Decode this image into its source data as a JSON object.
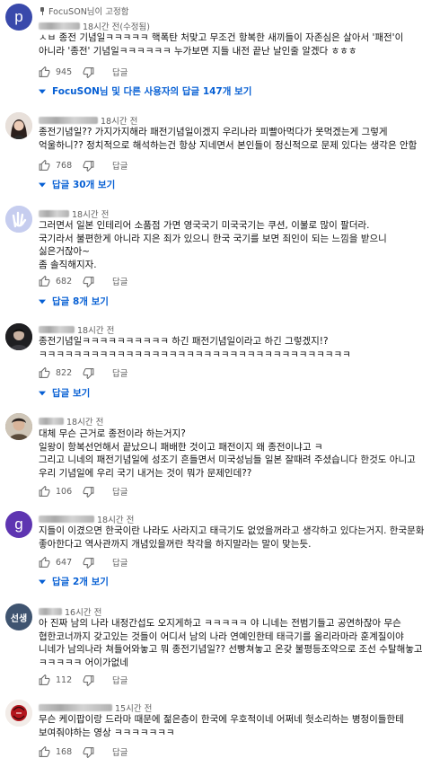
{
  "comments": [
    {
      "avatar": {
        "kind": "letter",
        "text": "p",
        "color": "#3949ab"
      },
      "pinned_text": "FocuSON님이 고정함",
      "time": "18시간 전(수정됨)",
      "text": "ㅅㅂ 종전 기념일ㅋㅋㅋㅋㅋ 핵폭탄 처맞고 무조건 항복한 새끼들이 자존심은 살아서 '패전'이 아니라 '종전' 기념일ㅋㅋㅋㅋㅋㅋ 누가보면 지들 내전 끝난 날인줄 알겠다 ㅎㅎㅎ",
      "likes": "945",
      "reply_label": "답글",
      "more_replies": "FocuSON님 및 다른 사용자의 답글 147개 보기"
    },
    {
      "avatar": {
        "kind": "photo",
        "color": "#7a6d68"
      },
      "time": "18시간 전",
      "text": "종전기념일?? 가지가지해라 패전기념일이겠지 우리나라 피빨아먹다가 못먹겠는게 그렇게 억울하니?? 정치적으로 해석하는건 항상 지네면서 본인들이 정신적으로 문제 있다는 생각은 안함",
      "likes": "768",
      "reply_label": "답글",
      "more_replies": "답글 30개 보기"
    },
    {
      "avatar": {
        "kind": "photo",
        "color": "#b8c3e6"
      },
      "time": "18시간 전",
      "text": "그러면서 일본 인테리어 소품점 가면 영국국기 미국국기는 쿠션, 이불로 많이 팔더라.\n국기라서 불편한게 아니라 지은 죄가 있으니 한국 국기를 보면 죄인이 되는 느낌을 받으니 싫은거잖아~\n좀 솔직해지자.",
      "likes": "682",
      "reply_label": "답글",
      "more_replies": "답글 8개 보기"
    },
    {
      "avatar": {
        "kind": "photo",
        "color": "#2a2a2a"
      },
      "time": "18시간 전",
      "text": "종전기념일ㅋㅋㅋㅋㅋㅋㅋㅋㅋㅋ 하긴 패전기념일이라고 하긴 그렇겠지!? ㅋㅋㅋㅋㅋㅋㅋㅋㅋㅋㅋㅋㅋㅋㅋㅋㅋㅋㅋㅋㅋㅋㅋㅋㅋㅋㅋㅋㅋㅋㅋㅋㅋㅋㅋㅋ",
      "likes": "822",
      "reply_label": "답글",
      "more_replies": "답글 보기"
    },
    {
      "avatar": {
        "kind": "photo",
        "color": "#8a7a66"
      },
      "time": "18시간 전",
      "text": "대체 무슨 근거로 종전이라 하는거지?\n일왕이 항복선언해서 끝났으니 패배한 것이고 패전이지 왜 종전이냐고 ㅋ\n그리고 니네의 패전기념일에 성조기 흔들면서 미국성님들 일본 잘때려 주셨습니다 한것도 아니고 우리 기념일에 우리 국기 내거는 것이 뭐가 문제인데??",
      "likes": "106",
      "reply_label": "답글"
    },
    {
      "avatar": {
        "kind": "letter",
        "text": "g",
        "color": "#5e35b1"
      },
      "time": "18시간 전",
      "text": "지들이 이겼으면 한국이란 나라도 사라지고 태극기도 없었을꺼라고 생각하고 있다는거지. 한국문화 좋아한다고 역사관까지 개념있을꺼란 착각을 하지말라는 말이 맞는듯.",
      "likes": "647",
      "reply_label": "답글",
      "more_replies": "답글 2개 보기"
    },
    {
      "avatar": {
        "kind": "letter",
        "text": "선생",
        "color": "#3f5470"
      },
      "time": "16시간 전",
      "text": "아 진짜 남의 나라 내정간섭도 오지게하고 ㅋㅋㅋㅋㅋ 야 니네는 전범기들고 공연하잖아 무슨 협한코너까지 갖고있는 것들이 어디서 남의 나라 연예인한테 태극기를 올리라마라 훈계질이야 니네가 남의나라 쳐들어와놓고 뭐 종전기념일?? 선빵쳐놓고 온갖 불평등조약으로 조선 수탈해놓고 ㅋㅋㅋㅋㅋ 어이가없네",
      "likes": "112",
      "reply_label": "답글"
    },
    {
      "avatar": {
        "kind": "photo",
        "color": "#efe9e4"
      },
      "time": "15시간 전",
      "text": "무슨 케이팝이랑 드라마 때문에 젊은층이 한국에 우호적이네 어쩌네 헛소리하는 병정이들한테 보여줘야하는 영상 ㅋㅋㅋㅋㅋㅋㅋ",
      "likes": "168",
      "reply_label": "답글"
    }
  ]
}
